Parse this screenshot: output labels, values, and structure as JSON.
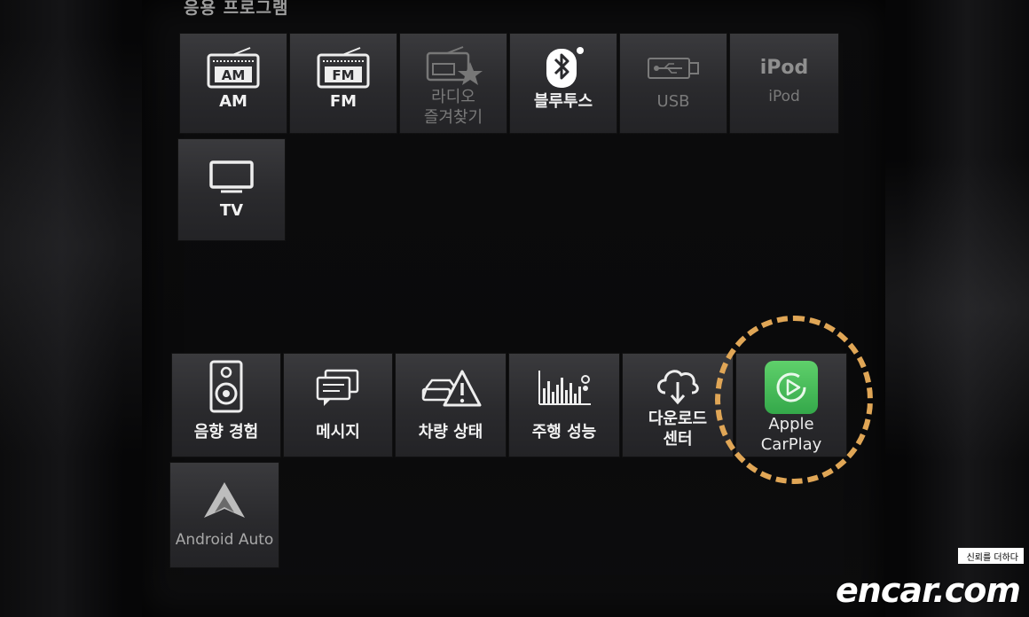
{
  "screen": {
    "title": "응용 프로그램"
  },
  "apps_top": [
    {
      "label": "AM",
      "icon": "am-radio-icon",
      "enabled": true
    },
    {
      "label": "FM",
      "icon": "fm-radio-icon",
      "enabled": true
    },
    {
      "label": "라디오\n즐겨찾기",
      "icon": "radio-favorites-icon",
      "enabled": false
    },
    {
      "label": "블루투스",
      "icon": "bluetooth-icon",
      "enabled": true
    },
    {
      "label": "USB",
      "icon": "usb-icon",
      "enabled": false
    },
    {
      "label": "iPod",
      "icon": "ipod-icon",
      "icon_text": "iPod",
      "enabled": false
    },
    {
      "label": "TV",
      "icon": "tv-icon",
      "enabled": true
    }
  ],
  "apps_bottom": [
    {
      "label": "음향 경험",
      "icon": "speaker-icon",
      "enabled": true
    },
    {
      "label": "메시지",
      "icon": "message-icon",
      "enabled": true
    },
    {
      "label": "차량 상태",
      "icon": "car-warning-icon",
      "enabled": true
    },
    {
      "label": "주행 성능",
      "icon": "performance-chart-icon",
      "enabled": true
    },
    {
      "label": "다운로드\n센터",
      "icon": "download-cloud-icon",
      "enabled": true
    },
    {
      "label": "Apple\nCarPlay",
      "icon": "carplay-icon",
      "enabled": true,
      "highlighted": true
    },
    {
      "label": "Android Auto",
      "icon": "android-auto-icon",
      "enabled": false
    }
  ],
  "watermark": {
    "tagline": "신뢰를 더하다",
    "brand": "encar.com"
  },
  "colors": {
    "highlight": "#e0a656",
    "carplay": "#4cc25a",
    "tile": "#2e2e31"
  }
}
